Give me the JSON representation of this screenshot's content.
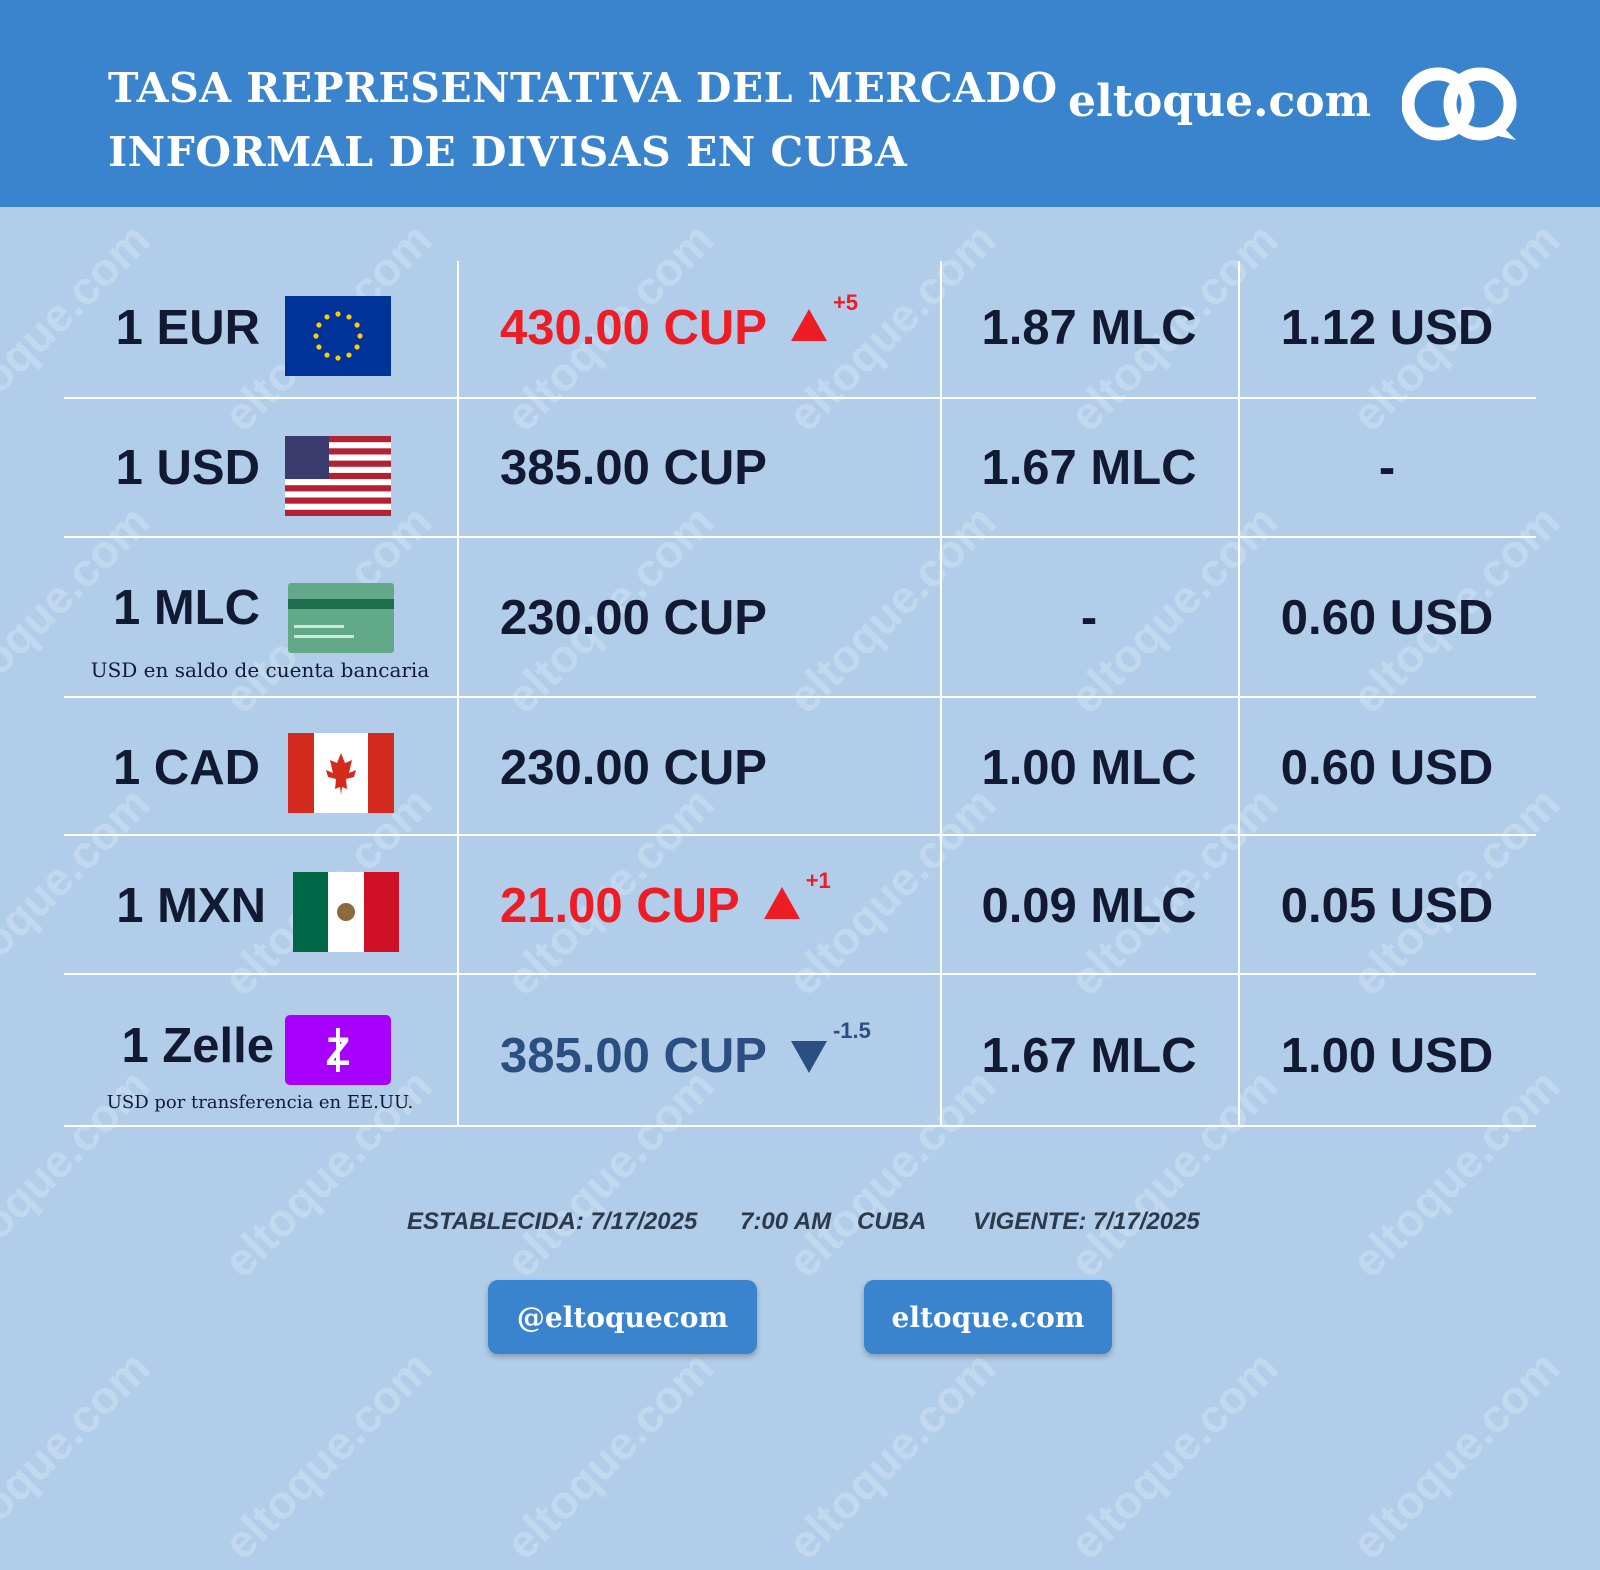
{
  "header": {
    "title_line1": "TASA REPRESENTATIVA DEL MERCADO",
    "title_line2": "INFORMAL DE DIVISAS EN CUBA",
    "brand": "eltoque.com"
  },
  "watermark": "eltoque.com",
  "colors": {
    "header": "#3a84ce",
    "background": "#b1cdea",
    "up": "#ee1c25",
    "down": "#2b4f80",
    "text": "#121a33"
  },
  "rows": [
    {
      "currency": "1 EUR",
      "flag": "eu-flag",
      "cup": "430.00 CUP",
      "trend": "up",
      "change": "+5",
      "mlc": "1.87 MLC",
      "usd": "1.12 USD"
    },
    {
      "currency": "1 USD",
      "flag": "us-flag",
      "cup": "385.00 CUP",
      "mlc": "1.67 MLC",
      "usd": "-"
    },
    {
      "currency": "1 MLC",
      "flag": "card-icon",
      "subtitle": "USD en saldo de cuenta bancaria",
      "cup": "230.00 CUP",
      "mlc": "-",
      "usd": "0.60 USD"
    },
    {
      "currency": "1 CAD",
      "flag": "ca-flag",
      "cup": "230.00 CUP",
      "mlc": "1.00 MLC",
      "usd": "0.60 USD"
    },
    {
      "currency": "1 MXN",
      "flag": "mx-flag",
      "cup": "21.00 CUP",
      "trend": "up",
      "change": "+1",
      "mlc": "0.09 MLC",
      "usd": "0.05 USD"
    },
    {
      "currency": "1 Zelle",
      "flag": "zelle-icon",
      "subtitle": "USD por transferencia en EE.UU.",
      "cup": "385.00 CUP",
      "trend": "down",
      "change": "-1.5",
      "mlc": "1.67 MLC",
      "usd": "1.00 USD"
    }
  ],
  "footer": {
    "established": "ESTABLECIDA: 7/17/2025",
    "time": "7:00 AM",
    "place": "CUBA",
    "valid": "VIGENTE: 7/17/2025"
  },
  "buttons": {
    "social": "@eltoquecom",
    "site": "eltoque.com"
  }
}
